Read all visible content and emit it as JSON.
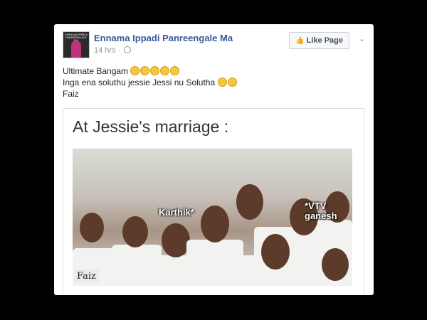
{
  "post": {
    "page_name": "Ennama Ippadi Panreengale Ma",
    "time": "14 hrs",
    "avatar_text": "ENNA MA IPPADI\nPANREENGALE MA",
    "like_button": "Like Page",
    "lines": [
      "Ultimate Bangam",
      "Inga ena soluthu jessie Jessi nu Solutha",
      "Faiz"
    ]
  },
  "shared": {
    "title": "At Jessie's marriage :",
    "labels": [
      "Karthik*",
      "*VTV\nganesh"
    ],
    "watermark": "Faiz"
  },
  "colors": {
    "link": "#365899",
    "meta": "#90949c",
    "background": "#000000"
  },
  "icons": [
    "globe-icon",
    "thumbs-up-icon",
    "chevron-down-icon",
    "grinning-face-icon"
  ]
}
